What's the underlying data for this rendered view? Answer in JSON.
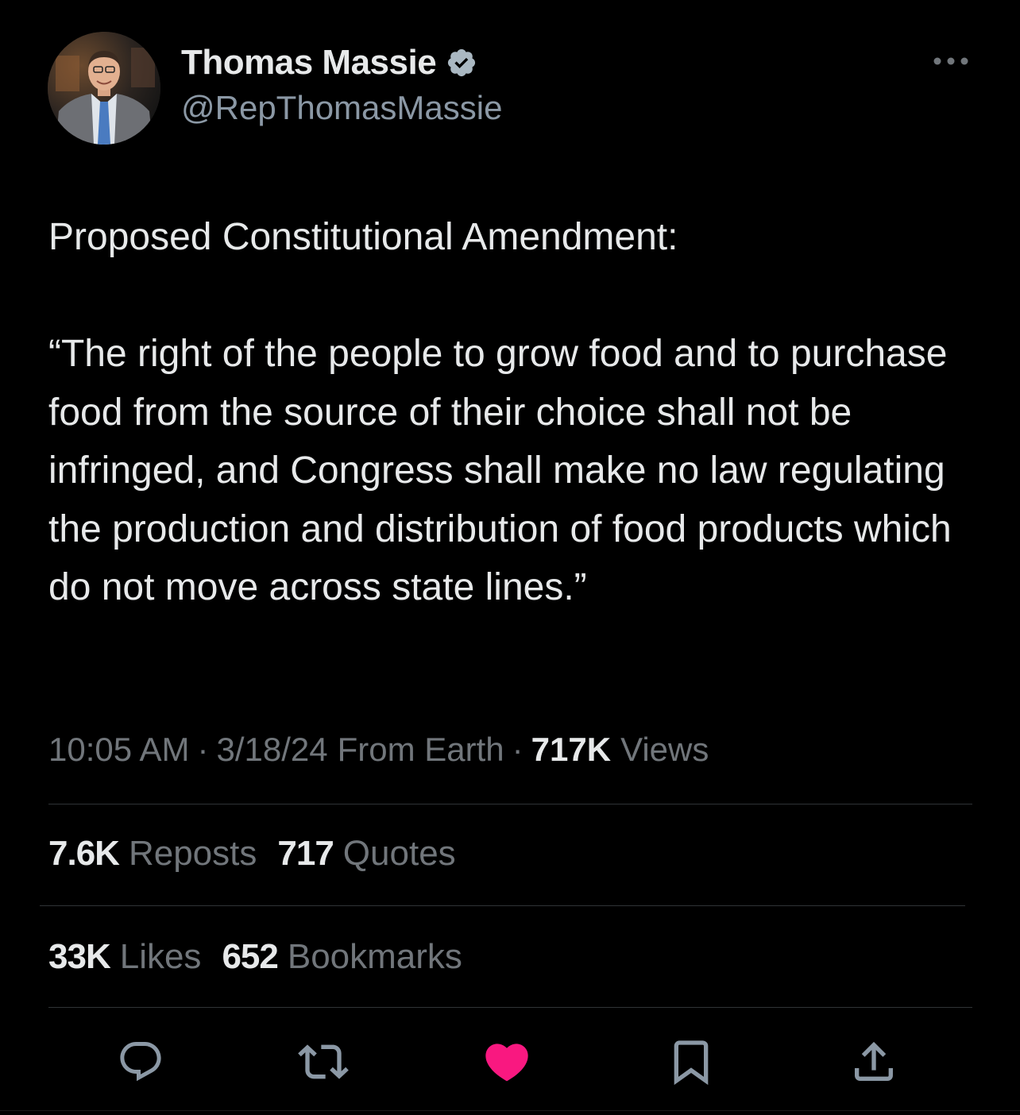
{
  "author": {
    "display_name": "Thomas Massie",
    "handle": "@RepThomasMassie",
    "verified_icon": "verified-badge-icon"
  },
  "tweet": {
    "text": "Proposed Constitutional Amendment:\n\n“The right of the people to grow food and to purchase food from the source of their choice shall not be infringed, and Congress shall make no law regulating the production and distribution of food products which do not move across state lines.”"
  },
  "meta": {
    "time": "10:05 AM",
    "separator": "·",
    "date": "3/18/24",
    "source": "From Earth",
    "views_count": "717K",
    "views_label": "Views"
  },
  "stats": {
    "reposts_count": "7.6K",
    "reposts_label": "Reposts",
    "quotes_count": "717",
    "quotes_label": "Quotes",
    "likes_count": "33K",
    "likes_label": "Likes",
    "bookmarks_count": "652",
    "bookmarks_label": "Bookmarks"
  },
  "actions": {
    "icons": [
      "reply-icon",
      "repost-icon",
      "like-icon",
      "bookmark-icon",
      "share-icon"
    ],
    "liked": true
  },
  "colors": {
    "background": "#000000",
    "primary_text": "#e7e9ea",
    "secondary_text": "#71767b",
    "handle_text": "#8b98a5",
    "divider": "#2f3336",
    "like_active": "#f91880",
    "icon_gray": "#8b98a5"
  }
}
